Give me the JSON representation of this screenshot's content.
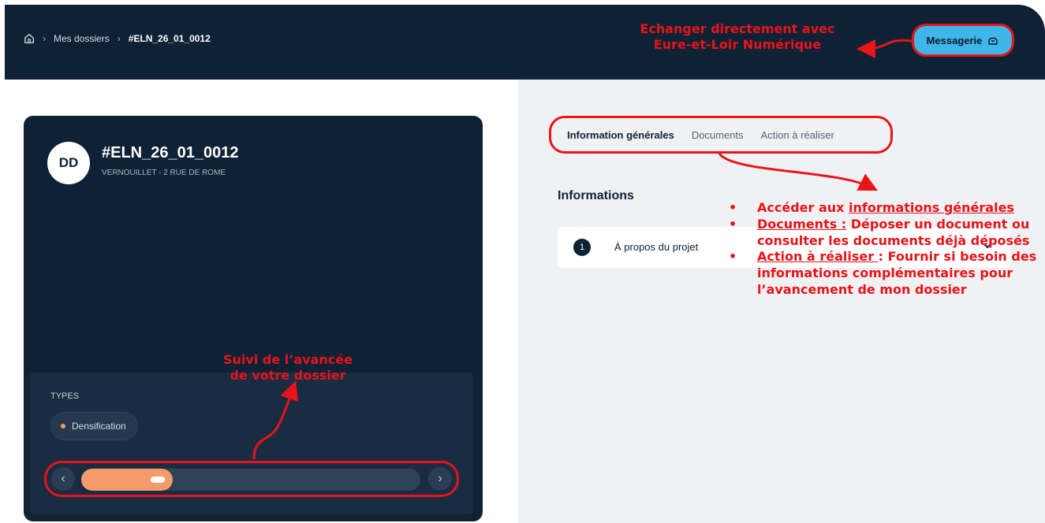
{
  "breadcrumb": {
    "items": [
      "Mes dossiers",
      "#ELN_26_01_0012"
    ]
  },
  "header": {
    "messagerie_label": "Messagerie"
  },
  "annotations": {
    "top_line1": "Echanger directement avec",
    "top_line2": "Eure-et-Loir Numérique",
    "progress_line1": "Suivi de l’avancée",
    "progress_line2": "de votre dossier",
    "bullet1_prefix": "Accéder aux ",
    "bullet1_link": "informations générales",
    "bullet2_link": "Documents :",
    "bullet2_text": " Déposer un document ou consulter les documents déjà déposés",
    "bullet3_link": "Action à réaliser ",
    "bullet3_colon": ":",
    "bullet3_text": " Fournir si besoin des informations complémentaires pour l’avancement de mon dossier"
  },
  "dossier": {
    "avatar_initials": "DD",
    "id": "#ELN_26_01_0012",
    "address": "VERNOUILLET - 2 RUE DE ROME",
    "types_label": "TYPES",
    "types": [
      "Densification"
    ],
    "progress_fraction": 0.27
  },
  "tabs": [
    "Information générales",
    "Documents",
    "Action à réaliser"
  ],
  "informations": {
    "title": "Informations",
    "sections": [
      {
        "number": "1",
        "title": "À propos du projet"
      }
    ]
  },
  "colors": {
    "navy": "#0f2135",
    "annotation_red": "#e8141a",
    "accent_blue": "#3fb6ea",
    "progress_orange": "#f59a6b"
  }
}
